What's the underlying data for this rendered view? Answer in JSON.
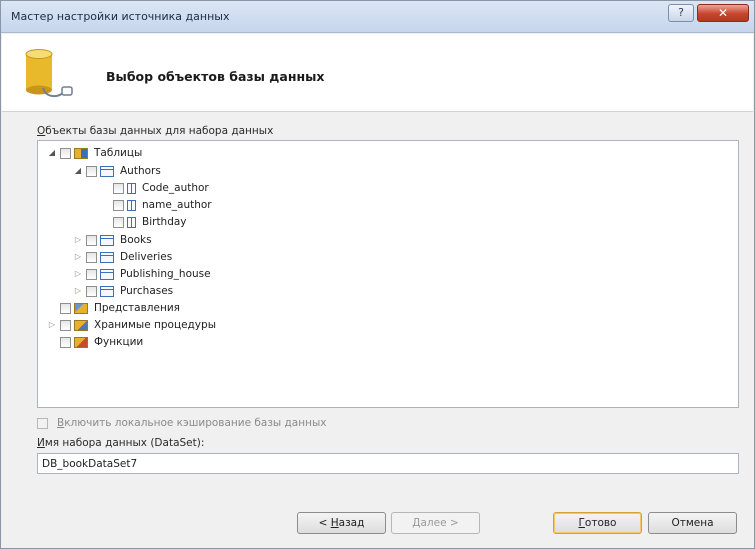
{
  "window": {
    "title": "Мастер настройки источника данных",
    "help_glyph": "?",
    "close_glyph": "✕"
  },
  "header": {
    "title": "Выбор объектов базы данных"
  },
  "objects": {
    "label_mnemonic": "О",
    "label_rest": "бъекты базы данных для набора данных"
  },
  "tree": {
    "tables": "Таблицы",
    "authors": "Authors",
    "authors_columns": [
      "Code_author",
      "name_author",
      "Birthday"
    ],
    "other_tables": [
      "Books",
      "Deliveries",
      "Publishing_house",
      "Purchases"
    ],
    "views": "Представления",
    "procedures": "Хранимые процедуры",
    "functions": "Функции",
    "expanded_glyph": "◢",
    "collapsed_glyph": "▷"
  },
  "cache": {
    "label_mnemonic": "В",
    "label_rest": "ключить локальное кэширование базы данных"
  },
  "dataset": {
    "label_mnemonic": "И",
    "label_rest": "мя набора данных (DataSet):",
    "value": "DB_bookDataSet7"
  },
  "buttons": {
    "back_prefix": "< ",
    "back_mnemonic": "Н",
    "back_rest": "азад",
    "next": "Далее >",
    "finish_mnemonic": "Г",
    "finish_rest": "отово",
    "cancel": "Отмена"
  },
  "colors": {
    "finish_border": "#d8a232",
    "close_button": "#c8452f"
  }
}
